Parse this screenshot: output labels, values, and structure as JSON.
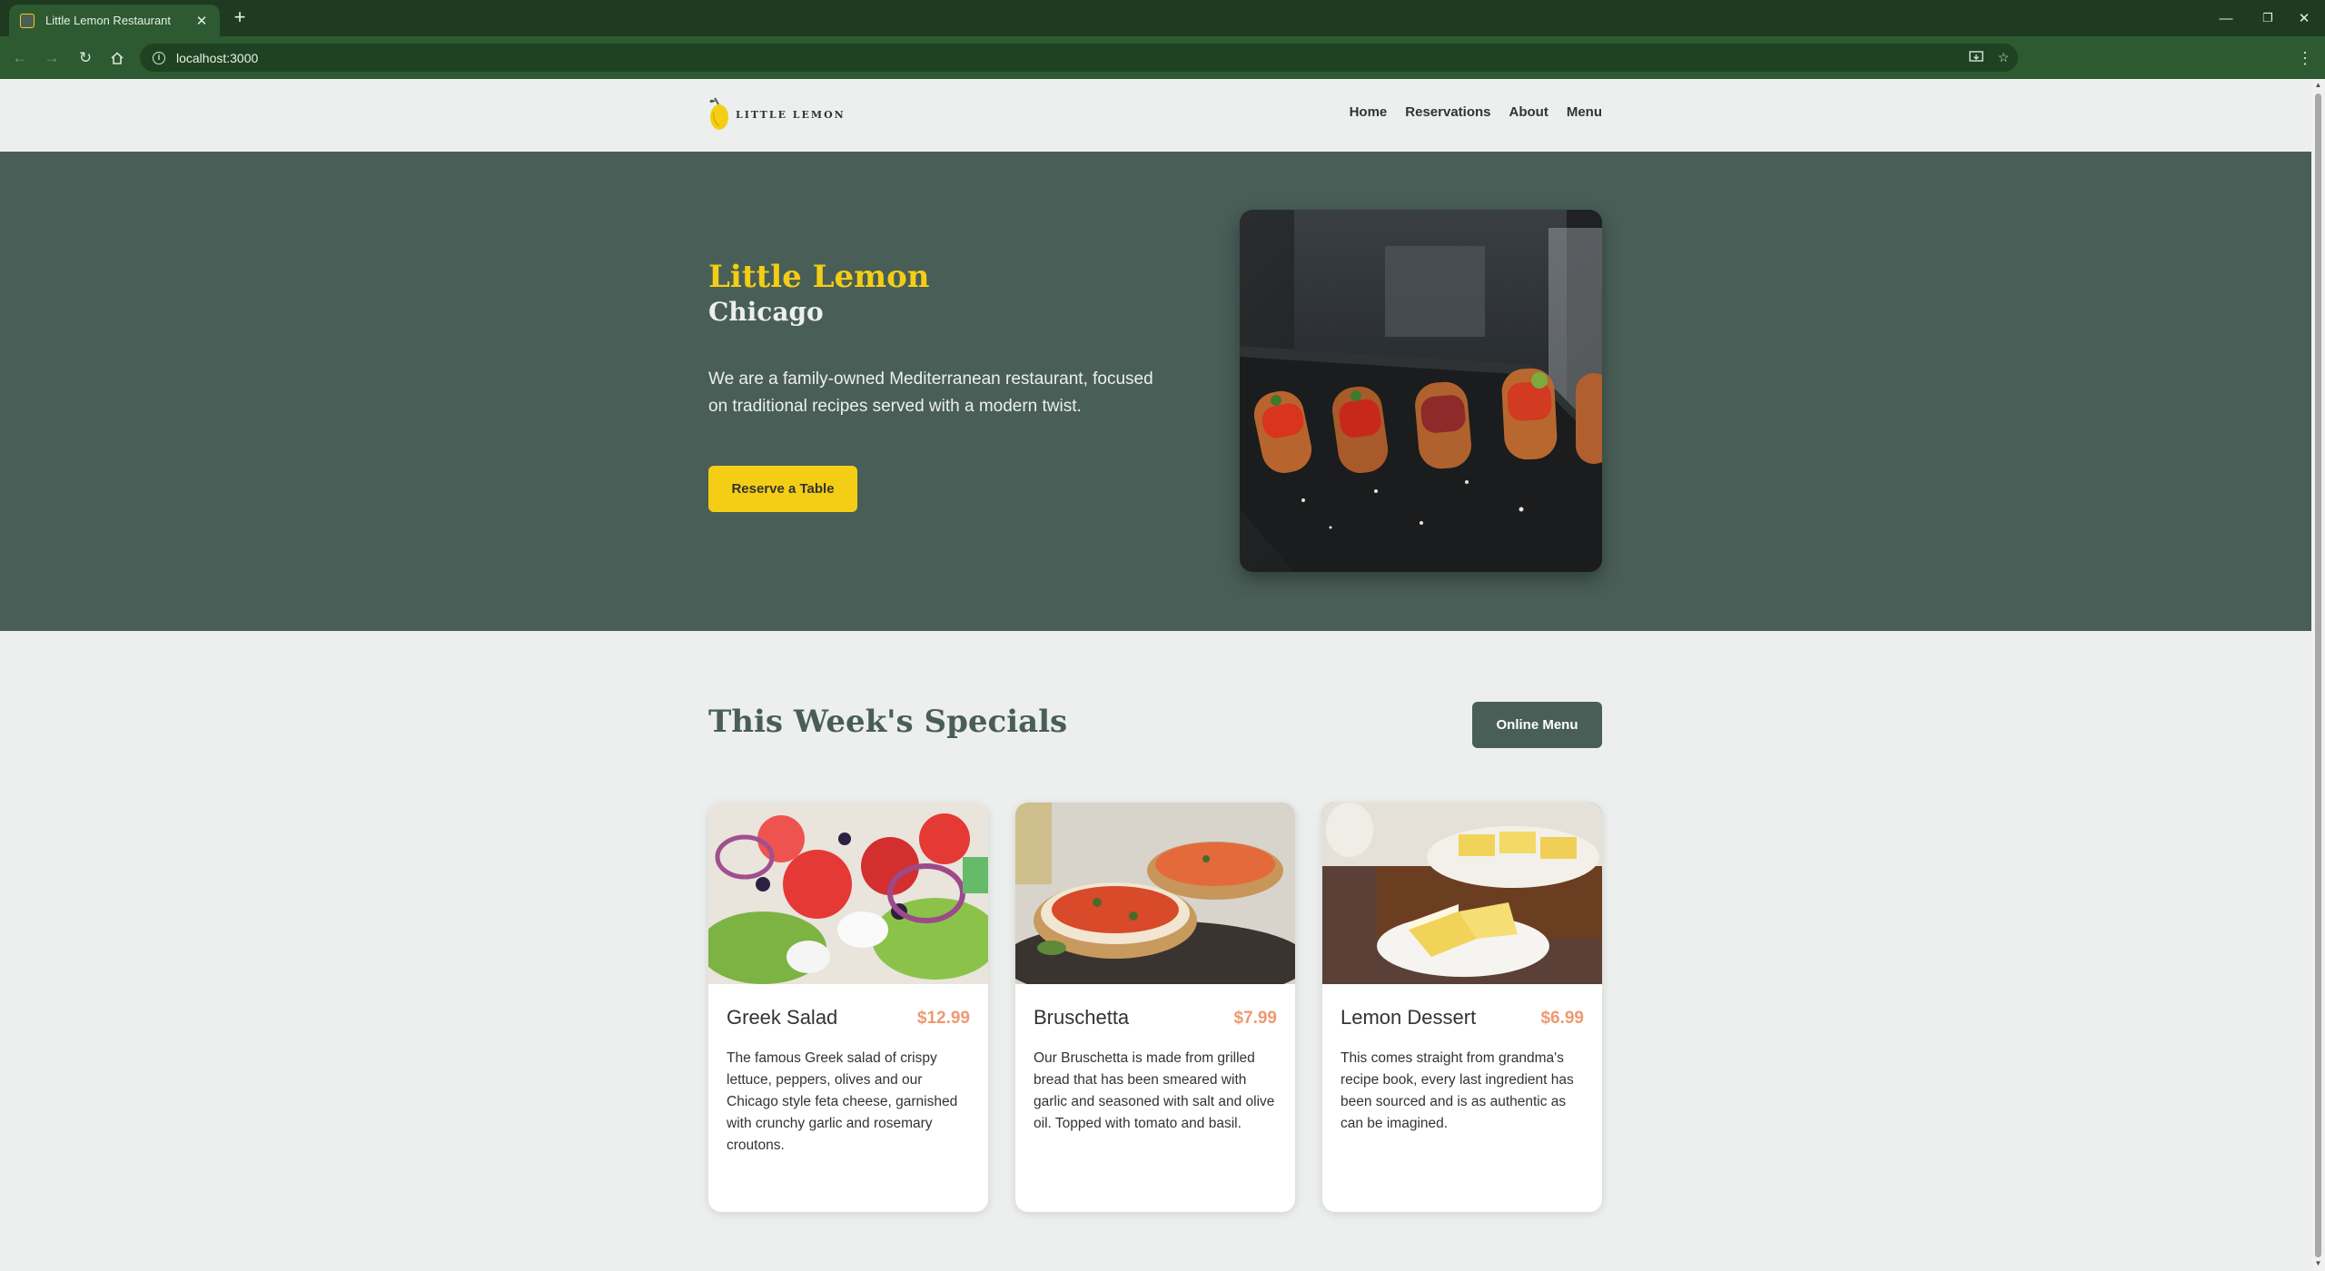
{
  "browser": {
    "tab_title": "Little Lemon Restaurant",
    "tab_close": "✕",
    "new_tab": "+",
    "url": "localhost:3000",
    "window_controls": {
      "minimize": "—",
      "restore": "❐",
      "close": "✕"
    },
    "icons": [
      "back-icon",
      "forward-icon",
      "reload-icon",
      "home-icon",
      "info-icon",
      "install-app-icon",
      "bookmark-star-icon",
      "kebab-menu-icon"
    ]
  },
  "header": {
    "logo_text": "LITTLE LEMON",
    "nav": [
      "Home",
      "Reservations",
      "About",
      "Menu"
    ]
  },
  "hero": {
    "title": "Little Lemon",
    "subtitle": "Chicago",
    "description": "We are a family-owned Mediterranean restaurant, focused on traditional recipes served with a modern twist.",
    "cta": "Reserve a Table"
  },
  "specials": {
    "title": "This Week's Specials",
    "button": "Online Menu",
    "items": [
      {
        "name": "Greek Salad",
        "price": "$12.99",
        "description": "The famous Greek salad of crispy lettuce, peppers, olives and our Chicago style feta cheese, garnished with crunchy garlic and rosemary croutons."
      },
      {
        "name": "Bruschetta",
        "price": "$7.99",
        "description": "Our Bruschetta is made from grilled bread that has been smeared with garlic and seasoned with salt and olive oil. Topped with tomato and basil."
      },
      {
        "name": "Lemon Dessert",
        "price": "$6.99",
        "description": "This comes straight from grandma's recipe book, every last ingredient has been sourced and is as authentic as can be imagined."
      }
    ]
  },
  "colors": {
    "primary_green": "#495E57",
    "primary_yellow": "#F4CE14",
    "price_salmon": "#EE9972",
    "background": "#EDEFEE",
    "browser_frame": "#1E3A20"
  }
}
